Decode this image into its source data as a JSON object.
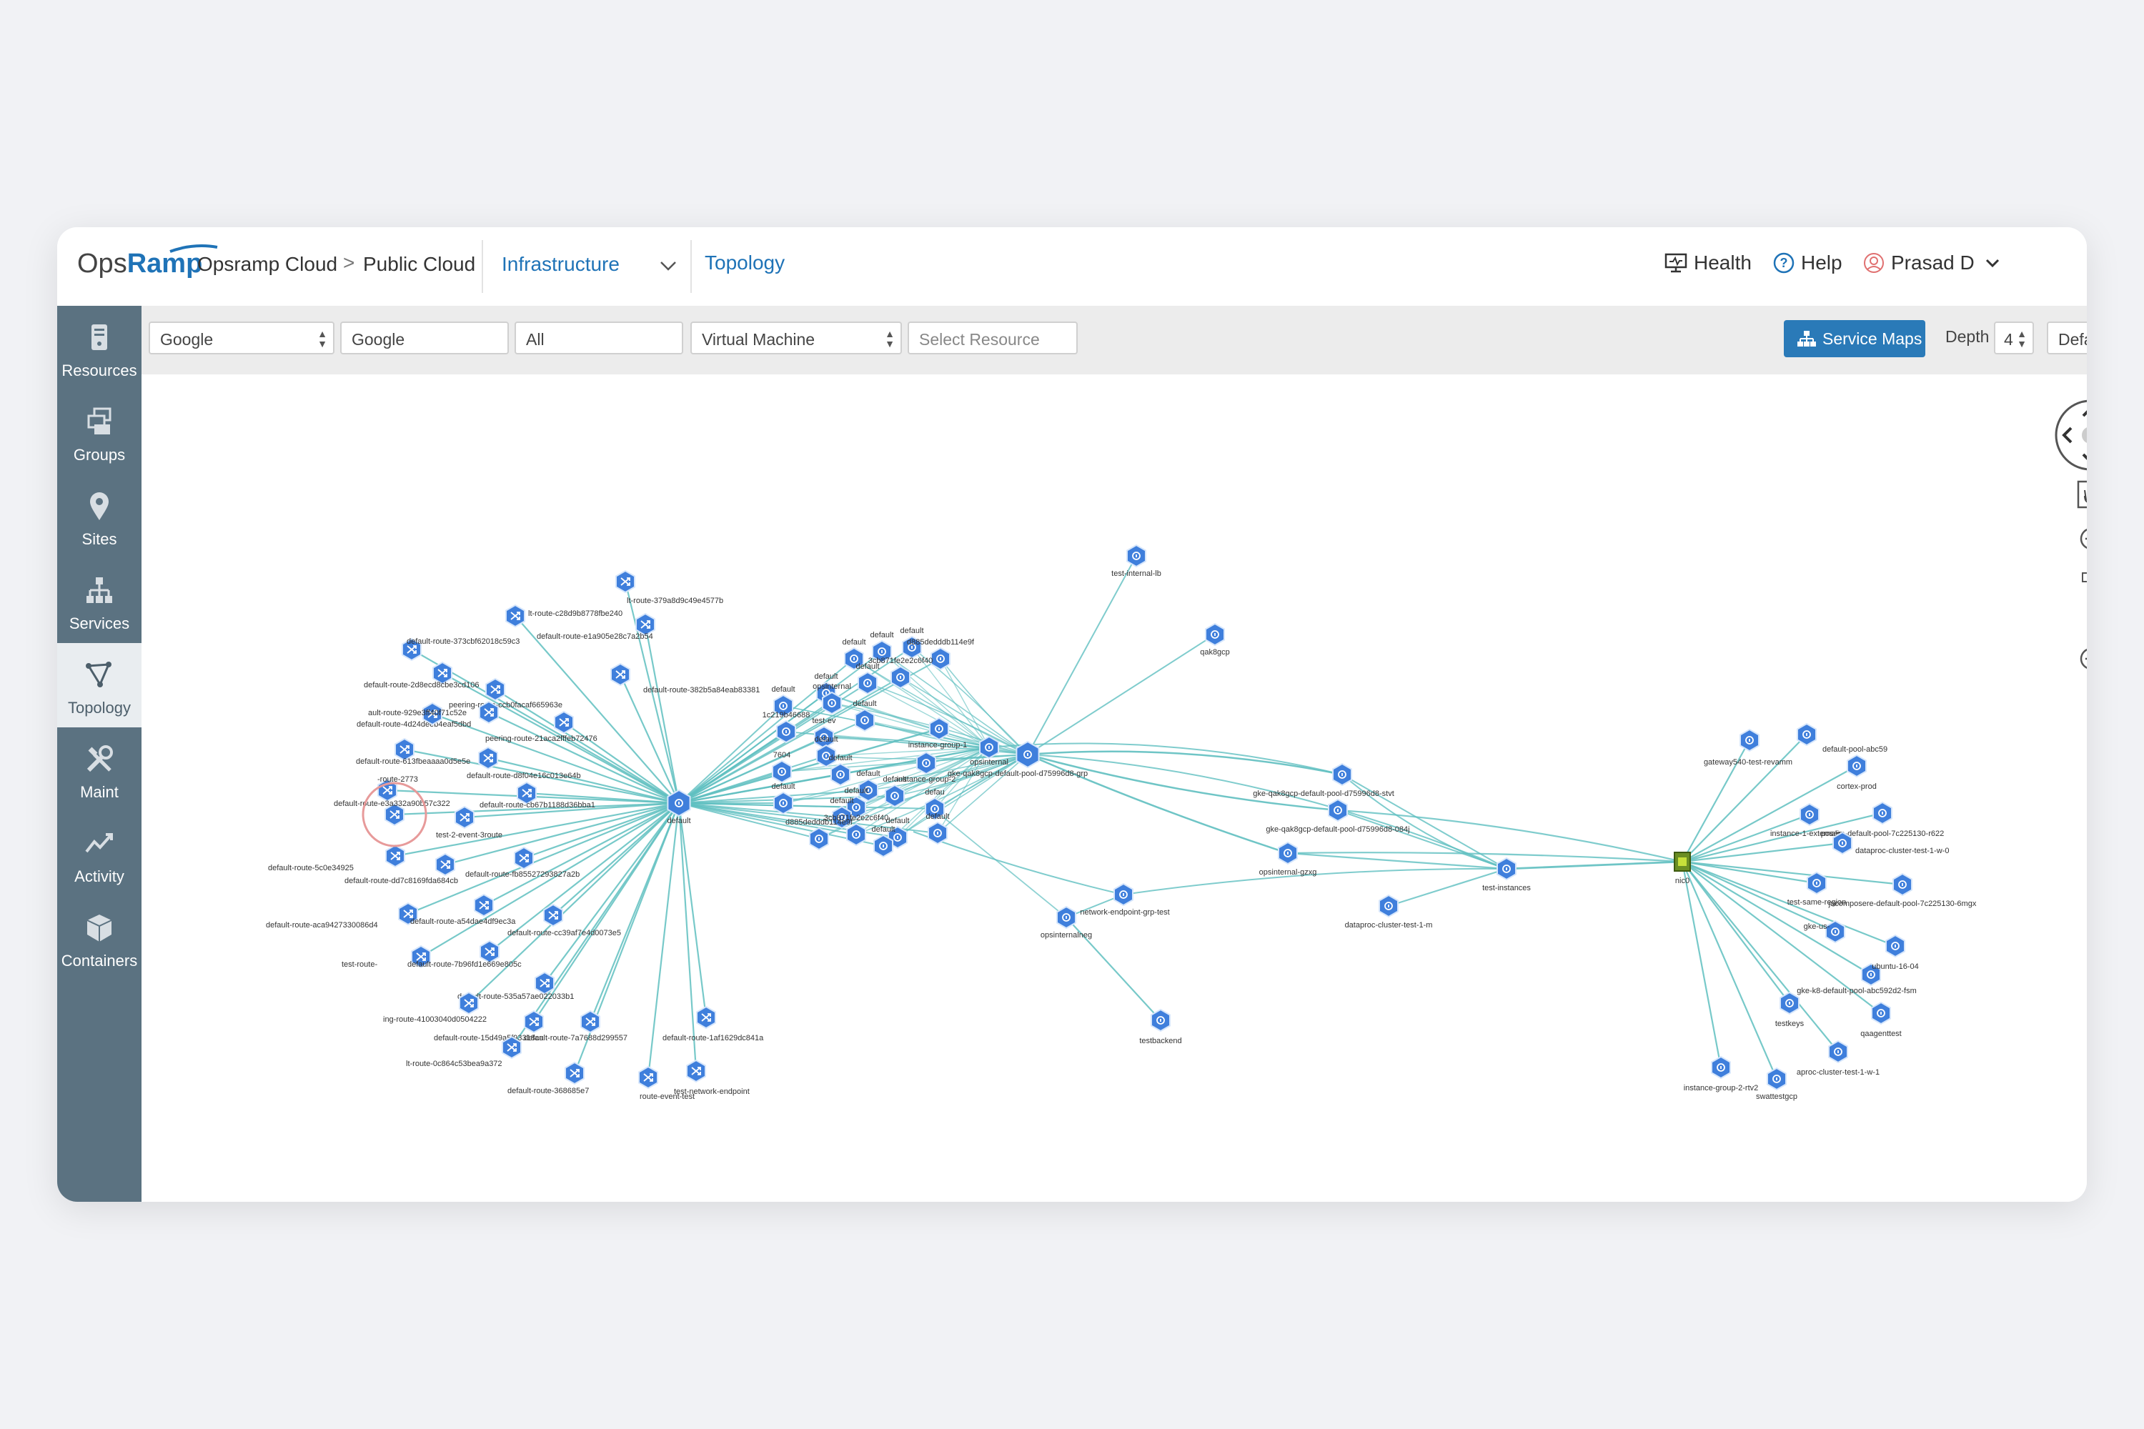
{
  "header": {
    "logo_text_a": "Ops",
    "logo_text_b": "Ramp",
    "breadcrumb_1": "Opsramp Cloud",
    "breadcrumb_sep": ">",
    "breadcrumb_2": "Public Cloud",
    "infra_select": "Infrastructure",
    "active_tab": "Topology",
    "health": "Health",
    "help": "Help",
    "user": "Prasad D"
  },
  "sidebar": {
    "items": [
      {
        "label": "Resources",
        "icon": "server-icon"
      },
      {
        "label": "Groups",
        "icon": "groups-icon"
      },
      {
        "label": "Sites",
        "icon": "map-pin-icon"
      },
      {
        "label": "Services",
        "icon": "hierarchy-icon"
      },
      {
        "label": "Topology",
        "icon": "topology-icon",
        "active": true
      },
      {
        "label": "Maint",
        "icon": "tools-icon"
      },
      {
        "label": "Activity",
        "icon": "activity-icon"
      },
      {
        "label": "Containers",
        "icon": "cube-icon"
      }
    ]
  },
  "filters": {
    "provider": "Google",
    "account": "Google",
    "region": "All",
    "resource_type": "Virtual Machine",
    "resource_placeholder": "Select Resource",
    "service_maps": "Service Maps",
    "depth_label": "Depth",
    "depth_value": "4",
    "layout": "Default"
  },
  "colors": {
    "accent": "#1f73b7",
    "sidebar": "#5b7281",
    "node": "#3f7fdc",
    "edge": "#5fbfc0",
    "button": "#2a7ab8"
  },
  "topology": {
    "hub_labels": {
      "default_left": "default",
      "gke_pool_grp": "gke-qak8gcp-default-pool-d75996d8-grp",
      "opsinternal": "opsinternal",
      "instance_group_1": "instance-group-1",
      "instance_group_2": "instance-group-2",
      "test_internal_lb": "test-internal-lb",
      "qak8gcp": "qak8gcp",
      "stvt": "gke-qak8gcp-default-pool-d75996d8-stvt",
      "084j": "gke-qak8gcp-default-pool-d75996d8-084j",
      "gzxg": "opsinternal-gzxg",
      "test_instances": "test-instances",
      "dataproc_m": "dataproc-cluster-test-1-m",
      "endpoint_grp": "network-endpoint-grp-test",
      "opsinternalneg": "opsinternalneg",
      "testbackend": "testbackend",
      "nic0": "nic0"
    },
    "route_labels": [
      "lt-route-379a8d9c49e4577b",
      "lt-route-c28d9b8778fbe240",
      "default-route-e1a905e28c7a2b54",
      "default-route-373cbf62018c59c3",
      "default-route-382b5a84eab83381",
      "default-route-2d8ecd8cbe3cd106",
      "peering-route-ccb0facaf665963e",
      "default-route-4d24deeb4eaf5dbd",
      "ault-route-929e3ff40f71c52e",
      "peering-route-21aca2fffeb72476",
      "default-route-613fbeaaaa0d5e5e",
      "default-route-d8f04e16c013e64b",
      "-route-2773",
      "default-route-cb67b1188d36bba1",
      "default-route-e3a332a90b57c322",
      "test-2-event-3route",
      "default-route-5c0e34925",
      "default-route-dd7c8169fda684cb",
      "default-route-fb85527293827a2b",
      "default-route-aca9427330086d4",
      "default-route-a54dae4df9ec3a",
      "default-route-cc39af7e4d0073e5",
      "test-route-",
      "default-route-7b96fd1e669e805c",
      "default-route-535a57ae022033b1",
      "ing-route-41003040d0504222",
      "default-route-15d49a5f93318ca",
      "lt-route-0c864c53bea9a372",
      "default-route-7a7688d299557",
      "default-route-368685e7",
      "route-event-test",
      "test-network-endpoint",
      "default-route-1af1629dc841a"
    ],
    "cluster_labels": [
      "default",
      "default",
      "default",
      "d885dedddb114e9f",
      "3cb871fe2e2c6f40",
      "default",
      "default",
      "default",
      "opsinternal",
      "default",
      "1c219b46688",
      "test-ev",
      "default",
      "7604",
      "default",
      "default",
      "default",
      "default",
      "default",
      "defau"
    ],
    "right_labels": [
      "gateway540-test-revamm",
      "default-pool-abc59",
      "cortex-prod",
      "instance-1-externalip",
      "posere-default-pool-7c225130-r622",
      "dataproc-cluster-test-1-w-0",
      "test-same-region",
      "jacomposere-default-pool-7c225130-6mgx",
      "gke-us-",
      "gke-k8-default-pool-abc592d2-fsm",
      "ubuntu-16-04",
      "testkeys",
      "qaagenttest",
      "instance-group-2-rtv2",
      "aproc-cluster-test-1-w-1",
      "swattestgcp"
    ]
  }
}
